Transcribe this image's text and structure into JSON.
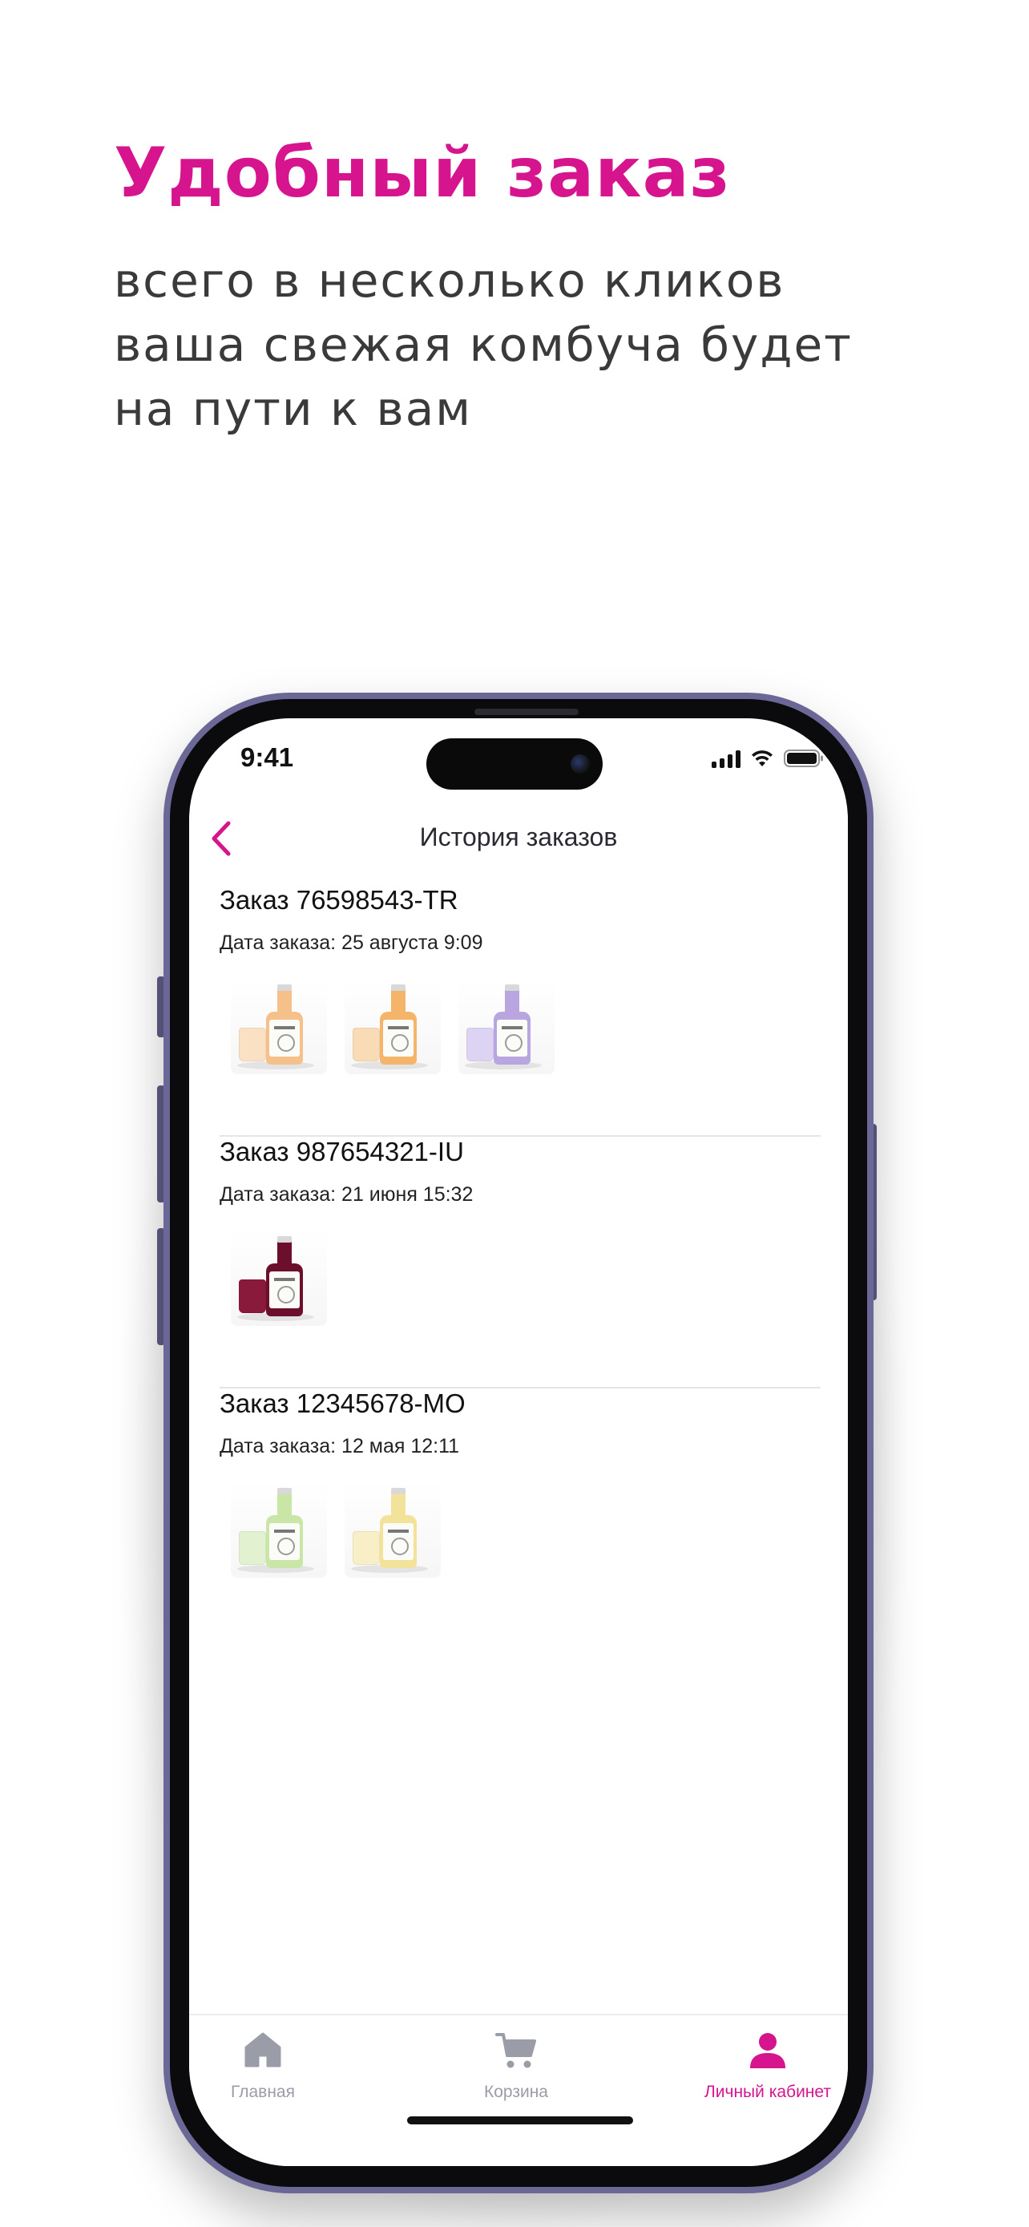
{
  "promo": {
    "title": "Удобный заказ",
    "subtitle_lines": [
      "всего в несколько кликов",
      "ваша свежая комбуча будет",
      "на пути к вам"
    ]
  },
  "status_bar": {
    "time": "9:41"
  },
  "header": {
    "title": "История заказов",
    "back_icon": "chevron-left-icon"
  },
  "orders": [
    {
      "title": "Заказ 76598543-TR",
      "date": "Дата заказа: 25 августа 9:09",
      "items": [
        {
          "name": "kombucha-bottle-peach",
          "liquid": "#f6c08a",
          "glass": "#fbe1c4"
        },
        {
          "name": "kombucha-bottle-orange",
          "liquid": "#f4b46a",
          "glass": "#f9dcb5"
        },
        {
          "name": "kombucha-bottle-lavender",
          "liquid": "#b9a6e0",
          "glass": "#ddd3f2"
        }
      ]
    },
    {
      "title": "Заказ 987654321-IU",
      "date": "Дата заказа: 21 июня 15:32",
      "items": [
        {
          "name": "kombucha-bottle-berry",
          "liquid": "#6b0f2c",
          "glass": "#8a1a3c"
        }
      ]
    },
    {
      "title": "Заказ 12345678-MO",
      "date": "Дата заказа: 12 мая 12:11",
      "items": [
        {
          "name": "kombucha-bottle-lime",
          "liquid": "#c9e6a6",
          "glass": "#e2f1cf"
        },
        {
          "name": "kombucha-bottle-lemon",
          "liquid": "#f3e39a",
          "glass": "#f8efc6"
        }
      ]
    }
  ],
  "tab_bar": {
    "tabs": [
      {
        "label": "Главная",
        "icon": "home-icon",
        "active": false
      },
      {
        "label": "Корзина",
        "icon": "cart-icon",
        "active": false
      },
      {
        "label": "Личный кабинет",
        "icon": "user-icon",
        "active": true
      }
    ]
  },
  "colors": {
    "accent": "#d5148e",
    "inactive": "#9a9ca8",
    "phone_frame": "#6b6897"
  }
}
